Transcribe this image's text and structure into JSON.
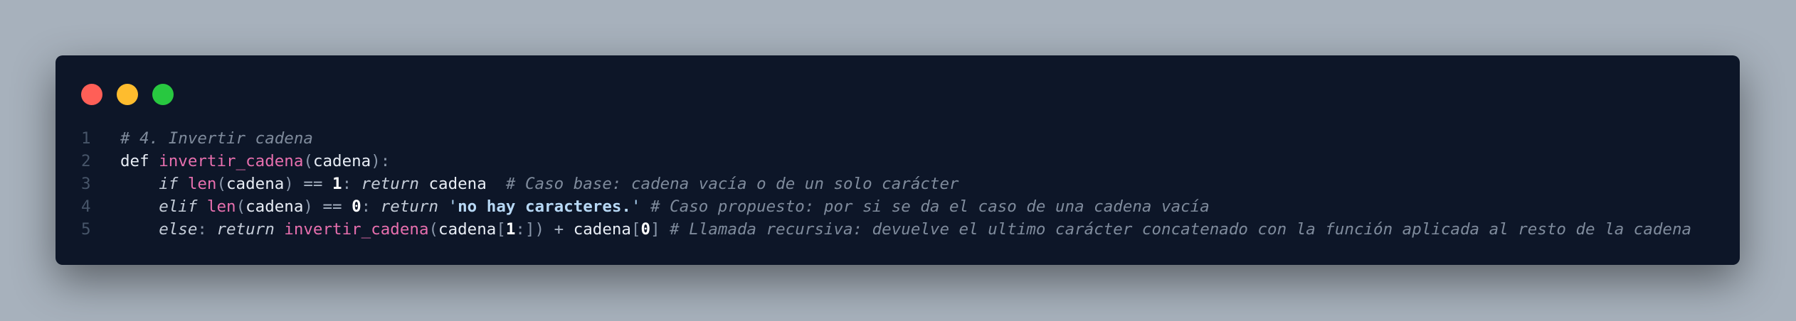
{
  "window": {
    "controls": [
      {
        "name": "close",
        "color": "#ff5f57"
      },
      {
        "name": "minimize",
        "color": "#febc2e"
      },
      {
        "name": "maximize",
        "color": "#28c840"
      }
    ]
  },
  "code": {
    "language": "python",
    "lines": [
      {
        "number": "1",
        "tokens": [
          {
            "t": "comment",
            "v": "# 4. Invertir cadena"
          }
        ]
      },
      {
        "number": "2",
        "tokens": [
          {
            "t": "kw",
            "v": "def"
          },
          {
            "t": "ws",
            "v": " "
          },
          {
            "t": "fn",
            "v": "invertir_cadena"
          },
          {
            "t": "punct",
            "v": "("
          },
          {
            "t": "id",
            "v": "cadena"
          },
          {
            "t": "punct",
            "v": "):"
          }
        ]
      },
      {
        "number": "3",
        "tokens": [
          {
            "t": "ws",
            "v": "    "
          },
          {
            "t": "kwi",
            "v": "if"
          },
          {
            "t": "ws",
            "v": " "
          },
          {
            "t": "builtin",
            "v": "len"
          },
          {
            "t": "punct",
            "v": "("
          },
          {
            "t": "id",
            "v": "cadena"
          },
          {
            "t": "punct",
            "v": ")"
          },
          {
            "t": "ws",
            "v": " "
          },
          {
            "t": "op",
            "v": "=="
          },
          {
            "t": "ws",
            "v": " "
          },
          {
            "t": "num",
            "v": "1"
          },
          {
            "t": "punct",
            "v": ":"
          },
          {
            "t": "ws",
            "v": " "
          },
          {
            "t": "kwi",
            "v": "return"
          },
          {
            "t": "ws",
            "v": " "
          },
          {
            "t": "id",
            "v": "cadena"
          },
          {
            "t": "ws",
            "v": "  "
          },
          {
            "t": "comment",
            "v": "# Caso base: cadena vacía o de un solo carácter"
          }
        ]
      },
      {
        "number": "4",
        "tokens": [
          {
            "t": "ws",
            "v": "    "
          },
          {
            "t": "kwi",
            "v": "elif"
          },
          {
            "t": "ws",
            "v": " "
          },
          {
            "t": "builtin",
            "v": "len"
          },
          {
            "t": "punct",
            "v": "("
          },
          {
            "t": "id",
            "v": "cadena"
          },
          {
            "t": "punct",
            "v": ")"
          },
          {
            "t": "ws",
            "v": " "
          },
          {
            "t": "op",
            "v": "=="
          },
          {
            "t": "ws",
            "v": " "
          },
          {
            "t": "num",
            "v": "0"
          },
          {
            "t": "punct",
            "v": ":"
          },
          {
            "t": "ws",
            "v": " "
          },
          {
            "t": "kwi",
            "v": "return"
          },
          {
            "t": "ws",
            "v": " "
          },
          {
            "t": "strq",
            "v": "'"
          },
          {
            "t": "str",
            "v": "no hay caracteres."
          },
          {
            "t": "strq",
            "v": "'"
          },
          {
            "t": "ws",
            "v": " "
          },
          {
            "t": "comment",
            "v": "# Caso propuesto: por si se da el caso de una cadena vacía"
          }
        ]
      },
      {
        "number": "5",
        "tokens": [
          {
            "t": "ws",
            "v": "    "
          },
          {
            "t": "kwi",
            "v": "else"
          },
          {
            "t": "punct",
            "v": ":"
          },
          {
            "t": "ws",
            "v": " "
          },
          {
            "t": "kwi",
            "v": "return"
          },
          {
            "t": "ws",
            "v": " "
          },
          {
            "t": "fn",
            "v": "invertir_cadena"
          },
          {
            "t": "punct",
            "v": "("
          },
          {
            "t": "id",
            "v": "cadena"
          },
          {
            "t": "punct",
            "v": "["
          },
          {
            "t": "num",
            "v": "1"
          },
          {
            "t": "punct",
            "v": ":])"
          },
          {
            "t": "ws",
            "v": " "
          },
          {
            "t": "op",
            "v": "+"
          },
          {
            "t": "ws",
            "v": " "
          },
          {
            "t": "id",
            "v": "cadena"
          },
          {
            "t": "punct",
            "v": "["
          },
          {
            "t": "num",
            "v": "0"
          },
          {
            "t": "punct",
            "v": "]"
          },
          {
            "t": "ws",
            "v": " "
          },
          {
            "t": "comment",
            "v": "# Llamada recursiva: devuelve el ultimo carácter concatenado con la función aplicada al resto de la cadena"
          }
        ]
      }
    ]
  }
}
